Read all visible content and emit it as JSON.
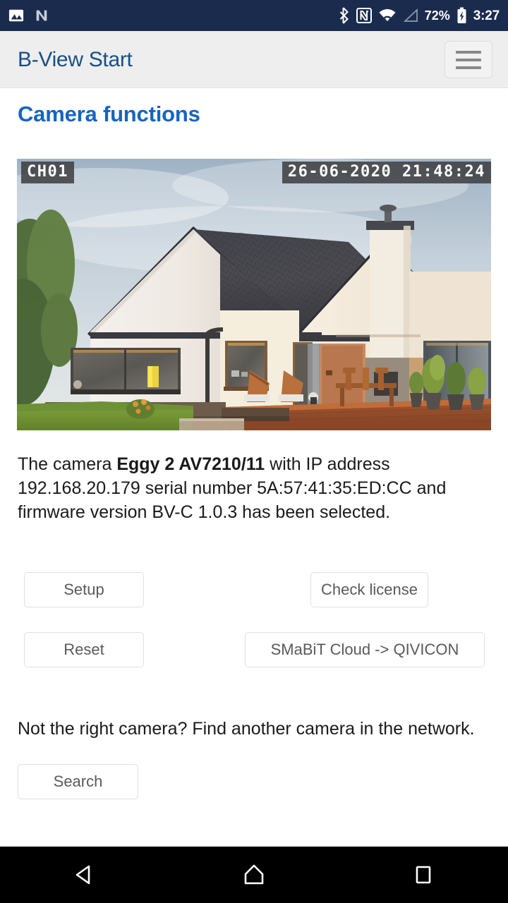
{
  "statusbar": {
    "background_color": "#1b2b4d",
    "left_icons": [
      {
        "name": "photo-image-icon",
        "glyph": "image"
      },
      {
        "name": "android-n-icon",
        "glyph": "N"
      }
    ],
    "right_icons": [
      {
        "name": "bluetooth-icon",
        "glyph": "bluetooth"
      },
      {
        "name": "nfc-icon",
        "glyph": "N"
      },
      {
        "name": "wifi-icon",
        "glyph": "wifi"
      },
      {
        "name": "cellular-signal-icon",
        "glyph": "signal-empty"
      }
    ],
    "battery_percent": "72%",
    "battery_icon": "battery-charging-icon",
    "clock": "3:27"
  },
  "appbar": {
    "title": "B-View Start",
    "title_color": "#1a4f82",
    "menu_button_name": "hamburger-menu-button"
  },
  "main": {
    "page_title": "Camera functions",
    "page_title_color": "#1565c0",
    "camera": {
      "channel_label": "CH01",
      "timestamp": "26-06-2020 21:48:24",
      "alt": "live camera preview of a modern single-family house with dark tiled roof, white walls, wooden terrace and garden"
    },
    "description": {
      "prefix": "The camera ",
      "camera_model": "Eggy 2 AV7210/11",
      "middle": " with IP address 192.168.20.179 serial number 5A:57:41:35:ED:CC and firmware version BV-C 1.0.3 has been selected.",
      "ip_address": "192.168.20.179",
      "serial_number": "5A:57:41:35:ED:CC",
      "firmware_version": "BV-C 1.0.3"
    },
    "buttons": {
      "setup": "Setup",
      "check_license": "Check license",
      "reset": "Reset",
      "cloud": "SMaBiT Cloud -> QIVICON",
      "search": "Search"
    },
    "subtext": "Not the right camera? Find another camera in the network."
  },
  "navbar": {
    "back": "back-button",
    "home": "home-button",
    "recents": "recents-button"
  }
}
